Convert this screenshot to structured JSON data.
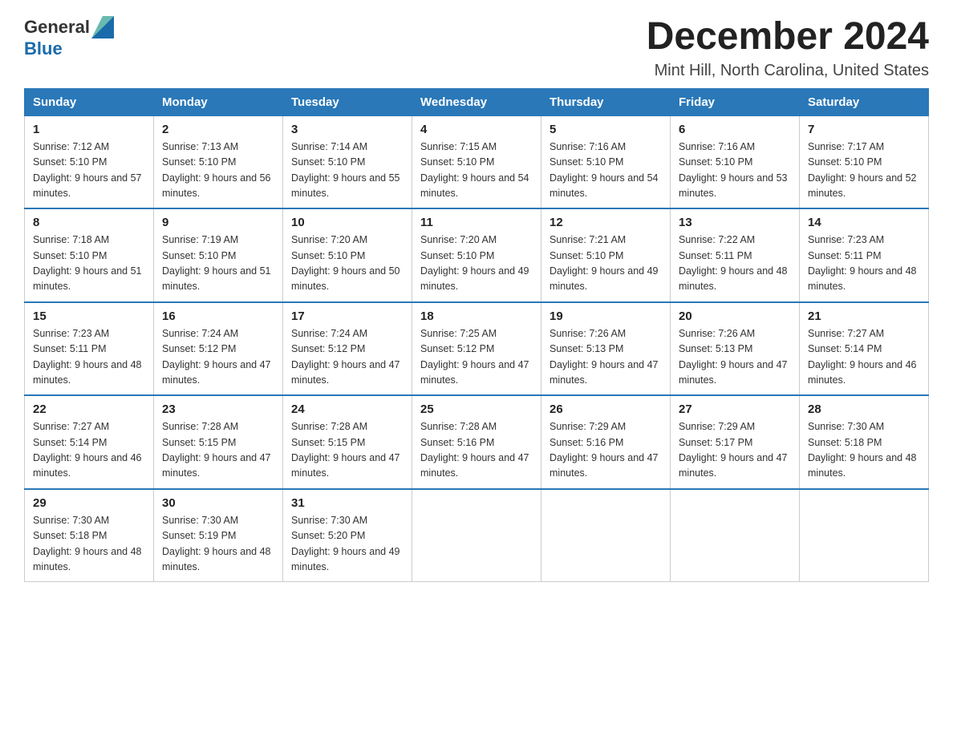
{
  "header": {
    "logo_general": "General",
    "logo_blue": "Blue",
    "month_title": "December 2024",
    "location": "Mint Hill, North Carolina, United States"
  },
  "days_of_week": [
    "Sunday",
    "Monday",
    "Tuesday",
    "Wednesday",
    "Thursday",
    "Friday",
    "Saturday"
  ],
  "weeks": [
    [
      {
        "day": "1",
        "sunrise": "7:12 AM",
        "sunset": "5:10 PM",
        "daylight": "9 hours and 57 minutes."
      },
      {
        "day": "2",
        "sunrise": "7:13 AM",
        "sunset": "5:10 PM",
        "daylight": "9 hours and 56 minutes."
      },
      {
        "day": "3",
        "sunrise": "7:14 AM",
        "sunset": "5:10 PM",
        "daylight": "9 hours and 55 minutes."
      },
      {
        "day": "4",
        "sunrise": "7:15 AM",
        "sunset": "5:10 PM",
        "daylight": "9 hours and 54 minutes."
      },
      {
        "day": "5",
        "sunrise": "7:16 AM",
        "sunset": "5:10 PM",
        "daylight": "9 hours and 54 minutes."
      },
      {
        "day": "6",
        "sunrise": "7:16 AM",
        "sunset": "5:10 PM",
        "daylight": "9 hours and 53 minutes."
      },
      {
        "day": "7",
        "sunrise": "7:17 AM",
        "sunset": "5:10 PM",
        "daylight": "9 hours and 52 minutes."
      }
    ],
    [
      {
        "day": "8",
        "sunrise": "7:18 AM",
        "sunset": "5:10 PM",
        "daylight": "9 hours and 51 minutes."
      },
      {
        "day": "9",
        "sunrise": "7:19 AM",
        "sunset": "5:10 PM",
        "daylight": "9 hours and 51 minutes."
      },
      {
        "day": "10",
        "sunrise": "7:20 AM",
        "sunset": "5:10 PM",
        "daylight": "9 hours and 50 minutes."
      },
      {
        "day": "11",
        "sunrise": "7:20 AM",
        "sunset": "5:10 PM",
        "daylight": "9 hours and 49 minutes."
      },
      {
        "day": "12",
        "sunrise": "7:21 AM",
        "sunset": "5:10 PM",
        "daylight": "9 hours and 49 minutes."
      },
      {
        "day": "13",
        "sunrise": "7:22 AM",
        "sunset": "5:11 PM",
        "daylight": "9 hours and 48 minutes."
      },
      {
        "day": "14",
        "sunrise": "7:23 AM",
        "sunset": "5:11 PM",
        "daylight": "9 hours and 48 minutes."
      }
    ],
    [
      {
        "day": "15",
        "sunrise": "7:23 AM",
        "sunset": "5:11 PM",
        "daylight": "9 hours and 48 minutes."
      },
      {
        "day": "16",
        "sunrise": "7:24 AM",
        "sunset": "5:12 PM",
        "daylight": "9 hours and 47 minutes."
      },
      {
        "day": "17",
        "sunrise": "7:24 AM",
        "sunset": "5:12 PM",
        "daylight": "9 hours and 47 minutes."
      },
      {
        "day": "18",
        "sunrise": "7:25 AM",
        "sunset": "5:12 PM",
        "daylight": "9 hours and 47 minutes."
      },
      {
        "day": "19",
        "sunrise": "7:26 AM",
        "sunset": "5:13 PM",
        "daylight": "9 hours and 47 minutes."
      },
      {
        "day": "20",
        "sunrise": "7:26 AM",
        "sunset": "5:13 PM",
        "daylight": "9 hours and 47 minutes."
      },
      {
        "day": "21",
        "sunrise": "7:27 AM",
        "sunset": "5:14 PM",
        "daylight": "9 hours and 46 minutes."
      }
    ],
    [
      {
        "day": "22",
        "sunrise": "7:27 AM",
        "sunset": "5:14 PM",
        "daylight": "9 hours and 46 minutes."
      },
      {
        "day": "23",
        "sunrise": "7:28 AM",
        "sunset": "5:15 PM",
        "daylight": "9 hours and 47 minutes."
      },
      {
        "day": "24",
        "sunrise": "7:28 AM",
        "sunset": "5:15 PM",
        "daylight": "9 hours and 47 minutes."
      },
      {
        "day": "25",
        "sunrise": "7:28 AM",
        "sunset": "5:16 PM",
        "daylight": "9 hours and 47 minutes."
      },
      {
        "day": "26",
        "sunrise": "7:29 AM",
        "sunset": "5:16 PM",
        "daylight": "9 hours and 47 minutes."
      },
      {
        "day": "27",
        "sunrise": "7:29 AM",
        "sunset": "5:17 PM",
        "daylight": "9 hours and 47 minutes."
      },
      {
        "day": "28",
        "sunrise": "7:30 AM",
        "sunset": "5:18 PM",
        "daylight": "9 hours and 48 minutes."
      }
    ],
    [
      {
        "day": "29",
        "sunrise": "7:30 AM",
        "sunset": "5:18 PM",
        "daylight": "9 hours and 48 minutes."
      },
      {
        "day": "30",
        "sunrise": "7:30 AM",
        "sunset": "5:19 PM",
        "daylight": "9 hours and 48 minutes."
      },
      {
        "day": "31",
        "sunrise": "7:30 AM",
        "sunset": "5:20 PM",
        "daylight": "9 hours and 49 minutes."
      },
      null,
      null,
      null,
      null
    ]
  ],
  "labels": {
    "sunrise_prefix": "Sunrise: ",
    "sunset_prefix": "Sunset: ",
    "daylight_prefix": "Daylight: "
  }
}
